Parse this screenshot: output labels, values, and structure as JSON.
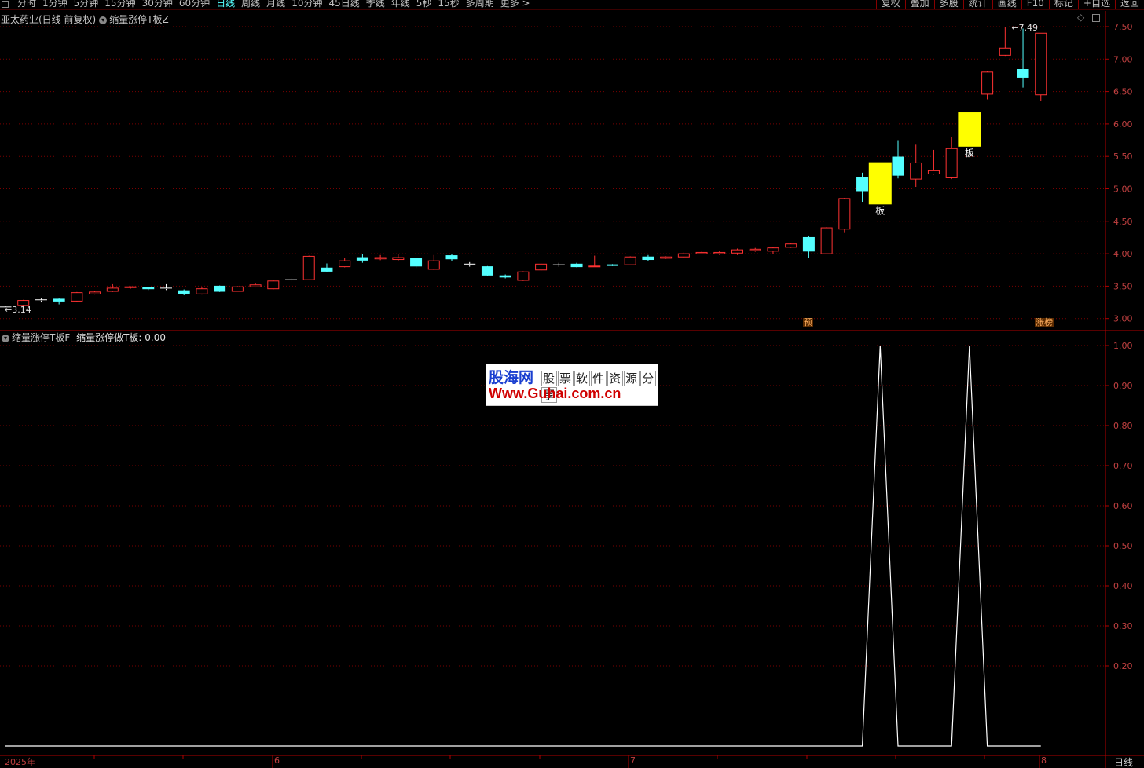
{
  "toolbar": {
    "periods": [
      "分时",
      "1分钟",
      "5分钟",
      "15分钟",
      "30分钟",
      "60分钟",
      "日线",
      "周线",
      "月线",
      "10分钟",
      "45日线",
      "季线",
      "年线",
      "5秒",
      "15秒",
      "多周期",
      "更多 >"
    ],
    "active_period": "日线",
    "right_tools": [
      "复权",
      "叠加",
      "多股",
      "统计",
      "画线",
      "F10",
      "标记",
      "+自选",
      "返回"
    ]
  },
  "price_panel": {
    "title": "亚太药业(日线 前复权)",
    "indicator": "缩量涨停T板Z",
    "high_label": "7.49",
    "low_label": "3.14",
    "tag_pre": "预",
    "tag_limit": "涨榜",
    "board_label": "板",
    "y_ticks": [
      "7.50",
      "7.00",
      "6.50",
      "6.00",
      "5.50",
      "5.00",
      "4.50",
      "4.00",
      "3.50",
      "3.00"
    ]
  },
  "indicator_panel": {
    "name": "缩量涨停T板F",
    "value_text": "缩量涨停做T板: 0.00",
    "y_ticks": [
      "1.00",
      "0.90",
      "0.80",
      "0.70",
      "0.60",
      "0.50",
      "0.40",
      "0.30",
      "0.20"
    ]
  },
  "x_axis": {
    "labels": [
      "2025年",
      "6",
      "7",
      "8"
    ],
    "period": "日线"
  },
  "watermark": {
    "cn": "股海网",
    "sub": [
      "股",
      "票",
      "软",
      "件",
      "资",
      "源",
      "分",
      "享"
    ],
    "url": "Www.Guhai.com.cn"
  },
  "colors": {
    "up": "#ff3232",
    "down": "#54ffff",
    "highlight": "#ffff00",
    "axis": "#b00000",
    "grid": "#7a0000",
    "line": "#ffffff"
  },
  "chart_data": {
    "type": "candlestick",
    "ylim": [
      3.0,
      7.5
    ],
    "candles": [
      {
        "o": 3.18,
        "c": 3.16,
        "h": 3.19,
        "l": 3.14,
        "d": "cross"
      },
      {
        "o": 3.2,
        "c": 3.28,
        "h": 3.29,
        "l": 3.19,
        "d": "up"
      },
      {
        "o": 3.29,
        "c": 3.29,
        "h": 3.31,
        "l": 3.25,
        "d": "cross"
      },
      {
        "o": 3.3,
        "c": 3.27,
        "h": 3.31,
        "l": 3.22,
        "d": "down"
      },
      {
        "o": 3.27,
        "c": 3.4,
        "h": 3.41,
        "l": 3.26,
        "d": "up"
      },
      {
        "o": 3.38,
        "c": 3.41,
        "h": 3.43,
        "l": 3.37,
        "d": "up"
      },
      {
        "o": 3.42,
        "c": 3.47,
        "h": 3.53,
        "l": 3.41,
        "d": "up"
      },
      {
        "o": 3.49,
        "c": 3.48,
        "h": 3.5,
        "l": 3.46,
        "d": "up"
      },
      {
        "o": 3.48,
        "c": 3.46,
        "h": 3.49,
        "l": 3.44,
        "d": "down"
      },
      {
        "o": 3.47,
        "c": 3.47,
        "h": 3.53,
        "l": 3.44,
        "d": "cross"
      },
      {
        "o": 3.43,
        "c": 3.39,
        "h": 3.45,
        "l": 3.36,
        "d": "down"
      },
      {
        "o": 3.38,
        "c": 3.46,
        "h": 3.48,
        "l": 3.37,
        "d": "up"
      },
      {
        "o": 3.5,
        "c": 3.42,
        "h": 3.51,
        "l": 3.41,
        "d": "down"
      },
      {
        "o": 3.42,
        "c": 3.49,
        "h": 3.5,
        "l": 3.42,
        "d": "up"
      },
      {
        "o": 3.49,
        "c": 3.52,
        "h": 3.55,
        "l": 3.48,
        "d": "up"
      },
      {
        "o": 3.46,
        "c": 3.58,
        "h": 3.6,
        "l": 3.45,
        "d": "up"
      },
      {
        "o": 3.6,
        "c": 3.6,
        "h": 3.63,
        "l": 3.57,
        "d": "cross"
      },
      {
        "o": 3.6,
        "c": 3.96,
        "h": 3.97,
        "l": 3.59,
        "d": "up"
      },
      {
        "o": 3.78,
        "c": 3.73,
        "h": 3.85,
        "l": 3.72,
        "d": "down"
      },
      {
        "o": 3.8,
        "c": 3.89,
        "h": 3.94,
        "l": 3.79,
        "d": "up"
      },
      {
        "o": 3.94,
        "c": 3.9,
        "h": 4.0,
        "l": 3.86,
        "d": "down"
      },
      {
        "o": 3.92,
        "c": 3.94,
        "h": 3.98,
        "l": 3.9,
        "d": "up"
      },
      {
        "o": 3.91,
        "c": 3.94,
        "h": 3.99,
        "l": 3.88,
        "d": "up"
      },
      {
        "o": 3.93,
        "c": 3.81,
        "h": 3.94,
        "l": 3.78,
        "d": "down"
      },
      {
        "o": 3.76,
        "c": 3.89,
        "h": 3.98,
        "l": 3.75,
        "d": "up"
      },
      {
        "o": 3.97,
        "c": 3.92,
        "h": 4.0,
        "l": 3.88,
        "d": "down"
      },
      {
        "o": 3.84,
        "c": 3.84,
        "h": 3.87,
        "l": 3.8,
        "d": "cross"
      },
      {
        "o": 3.8,
        "c": 3.67,
        "h": 3.81,
        "l": 3.65,
        "d": "down"
      },
      {
        "o": 3.66,
        "c": 3.64,
        "h": 3.68,
        "l": 3.62,
        "d": "down"
      },
      {
        "o": 3.59,
        "c": 3.72,
        "h": 3.73,
        "l": 3.58,
        "d": "up"
      },
      {
        "o": 3.75,
        "c": 3.84,
        "h": 3.85,
        "l": 3.74,
        "d": "up"
      },
      {
        "o": 3.83,
        "c": 3.83,
        "h": 3.86,
        "l": 3.8,
        "d": "cross"
      },
      {
        "o": 3.84,
        "c": 3.8,
        "h": 3.86,
        "l": 3.79,
        "d": "down"
      },
      {
        "o": 3.81,
        "c": 3.81,
        "h": 3.97,
        "l": 3.81,
        "d": "up"
      },
      {
        "o": 3.83,
        "c": 3.82,
        "h": 3.84,
        "l": 3.81,
        "d": "down"
      },
      {
        "o": 3.83,
        "c": 3.95,
        "h": 3.96,
        "l": 3.82,
        "d": "up"
      },
      {
        "o": 3.95,
        "c": 3.91,
        "h": 3.98,
        "l": 3.89,
        "d": "down"
      },
      {
        "o": 3.93,
        "c": 3.95,
        "h": 3.96,
        "l": 3.92,
        "d": "up"
      },
      {
        "o": 3.95,
        "c": 4.0,
        "h": 4.02,
        "l": 3.94,
        "d": "up"
      },
      {
        "o": 4.0,
        "c": 4.02,
        "h": 4.03,
        "l": 3.99,
        "d": "up"
      },
      {
        "o": 4.0,
        "c": 4.02,
        "h": 4.04,
        "l": 3.98,
        "d": "up"
      },
      {
        "o": 4.01,
        "c": 4.06,
        "h": 4.08,
        "l": 3.98,
        "d": "up"
      },
      {
        "o": 4.05,
        "c": 4.07,
        "h": 4.09,
        "l": 4.03,
        "d": "up"
      },
      {
        "o": 4.04,
        "c": 4.09,
        "h": 4.11,
        "l": 4.0,
        "d": "up"
      },
      {
        "o": 4.1,
        "c": 4.15,
        "h": 4.16,
        "l": 4.09,
        "d": "up"
      },
      {
        "o": 4.25,
        "c": 4.04,
        "h": 4.28,
        "l": 3.93,
        "d": "down"
      },
      {
        "o": 4.0,
        "c": 4.4,
        "h": 4.41,
        "l": 3.99,
        "d": "up"
      },
      {
        "o": 4.38,
        "c": 4.85,
        "h": 4.86,
        "l": 4.32,
        "d": "up"
      },
      {
        "o": 5.18,
        "c": 4.97,
        "h": 5.25,
        "l": 4.8,
        "d": "down"
      },
      {
        "o": 4.76,
        "c": 5.41,
        "h": 5.41,
        "l": 4.76,
        "d": "board"
      },
      {
        "o": 5.49,
        "c": 5.21,
        "h": 5.75,
        "l": 5.16,
        "d": "down"
      },
      {
        "o": 5.15,
        "c": 5.4,
        "h": 5.68,
        "l": 5.03,
        "d": "up"
      },
      {
        "o": 5.23,
        "c": 5.28,
        "h": 5.6,
        "l": 5.22,
        "d": "up"
      },
      {
        "o": 5.17,
        "c": 5.62,
        "h": 5.8,
        "l": 5.15,
        "d": "up"
      },
      {
        "o": 5.65,
        "c": 6.18,
        "h": 6.18,
        "l": 5.65,
        "d": "board"
      },
      {
        "o": 6.46,
        "c": 6.8,
        "h": 6.82,
        "l": 6.38,
        "d": "up"
      },
      {
        "o": 7.06,
        "c": 7.17,
        "h": 7.49,
        "l": 7.05,
        "d": "up"
      },
      {
        "o": 6.84,
        "c": 6.72,
        "h": 7.47,
        "l": 6.56,
        "d": "down"
      },
      {
        "o": 6.45,
        "c": 7.4,
        "h": 7.4,
        "l": 6.35,
        "d": "up"
      }
    ],
    "indicator": {
      "ylim": [
        0,
        1
      ],
      "values": [
        0,
        0,
        0,
        0,
        0,
        0,
        0,
        0,
        0,
        0,
        0,
        0,
        0,
        0,
        0,
        0,
        0,
        0,
        0,
        0,
        0,
        0,
        0,
        0,
        0,
        0,
        0,
        0,
        0,
        0,
        0,
        0,
        0,
        0,
        0,
        0,
        0,
        0,
        0,
        0,
        0,
        0,
        0,
        0,
        0,
        0,
        0,
        0,
        0,
        1,
        0,
        0,
        0,
        0,
        1,
        0,
        0,
        0,
        0
      ]
    }
  }
}
